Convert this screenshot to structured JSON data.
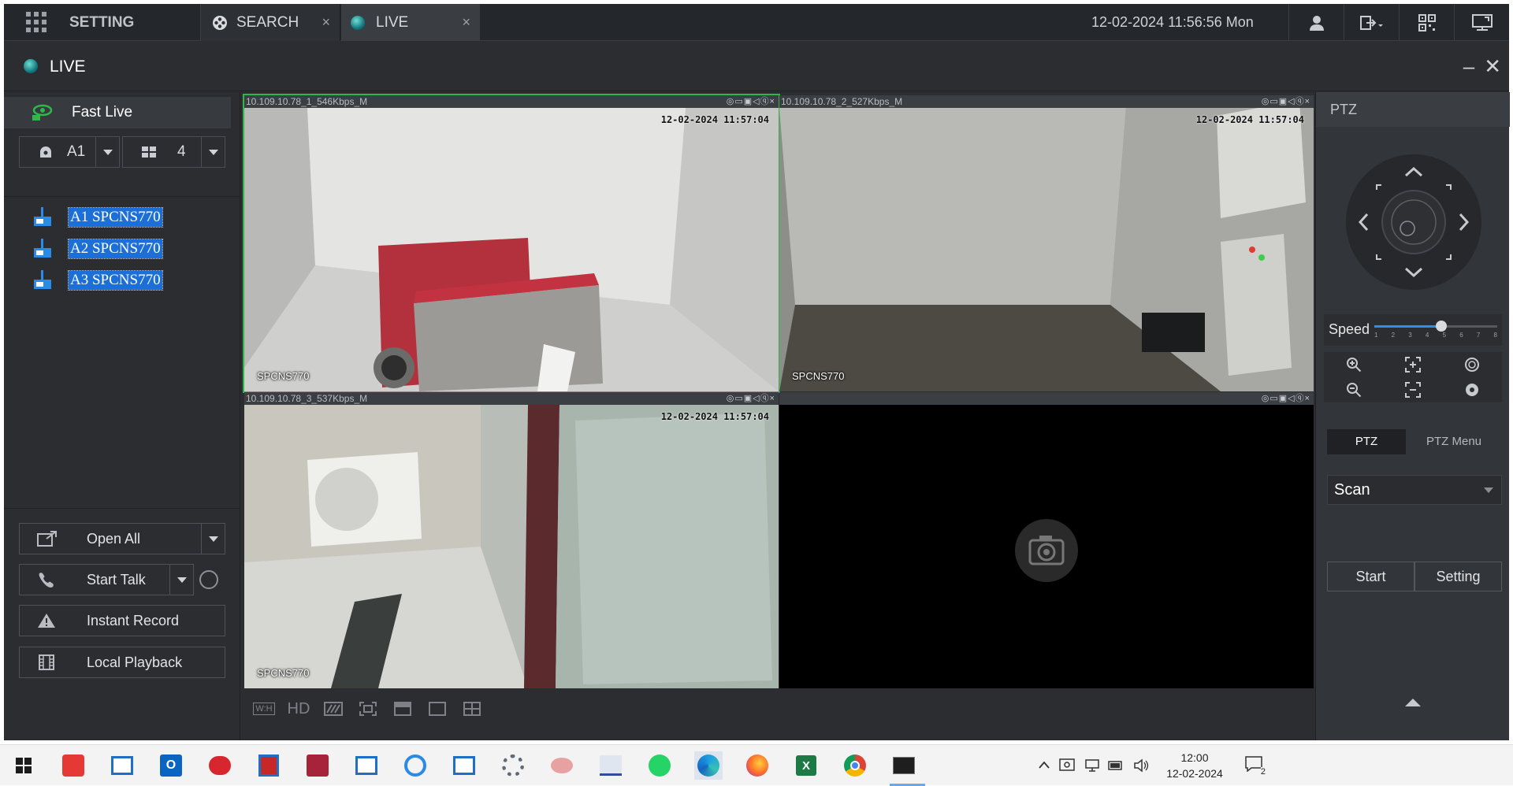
{
  "topbar": {
    "setting_label": "SETTING",
    "tabs": [
      {
        "label": "SEARCH",
        "close": "×"
      },
      {
        "label": "LIVE",
        "close": "×"
      }
    ],
    "datetime": "12-02-2024 11:56:56 Mon",
    "icons": [
      "user-icon",
      "logout-icon",
      "qr-code-icon",
      "monitor-icon"
    ]
  },
  "live_header": {
    "title": "LIVE",
    "minimize": "–",
    "close": "✕"
  },
  "left": {
    "fast_live": "Fast Live",
    "selector_channel": "A1",
    "selector_split": "4",
    "devices": [
      {
        "label": "A1 SPCNS770"
      },
      {
        "label": "A2 SPCNS770"
      },
      {
        "label": "A3 SPCNS770"
      }
    ],
    "buttons": {
      "open_all": "Open All",
      "start_talk": "Start Talk",
      "instant_record": "Instant Record",
      "local_playback": "Local Playback"
    }
  },
  "video": {
    "cells": [
      {
        "bar": "10.109.10.78_1_546Kbps_M",
        "time": "12-02-2024 11:57:04",
        "name": "SPCNS770",
        "selected": true
      },
      {
        "bar": "10.109.10.78_2_527Kbps_M",
        "time": "12-02-2024 11:57:04",
        "name": "SPCNS770",
        "selected": false
      },
      {
        "bar": "10.109.10.78_3_537Kbps_M",
        "time": "12-02-2024 11:57:04",
        "name": "SPCNS770",
        "selected": false
      },
      {
        "bar": "",
        "time": "",
        "name": "",
        "selected": false
      }
    ],
    "cell_icons": "◎▭▣◁ⓠ×",
    "hd_label": "HD",
    "wh_label": "W:H"
  },
  "ptz": {
    "title": "PTZ",
    "speed_label": "Speed",
    "speed_ticks": [
      "1",
      "2",
      "3",
      "4",
      "5",
      "6",
      "7",
      "8"
    ],
    "speed_value": 5,
    "tab_ptz": "PTZ",
    "tab_ptz_menu": "PTZ Menu",
    "mode": "Scan",
    "start": "Start",
    "setting": "Setting"
  },
  "taskbar": {
    "time": "12:00",
    "date": "12-02-2024",
    "notification_count": "2"
  },
  "colors": {
    "accent_green": "#2fb84a",
    "device_highlight": "#1d6fd8",
    "panel_bg": "#2b2d30"
  }
}
